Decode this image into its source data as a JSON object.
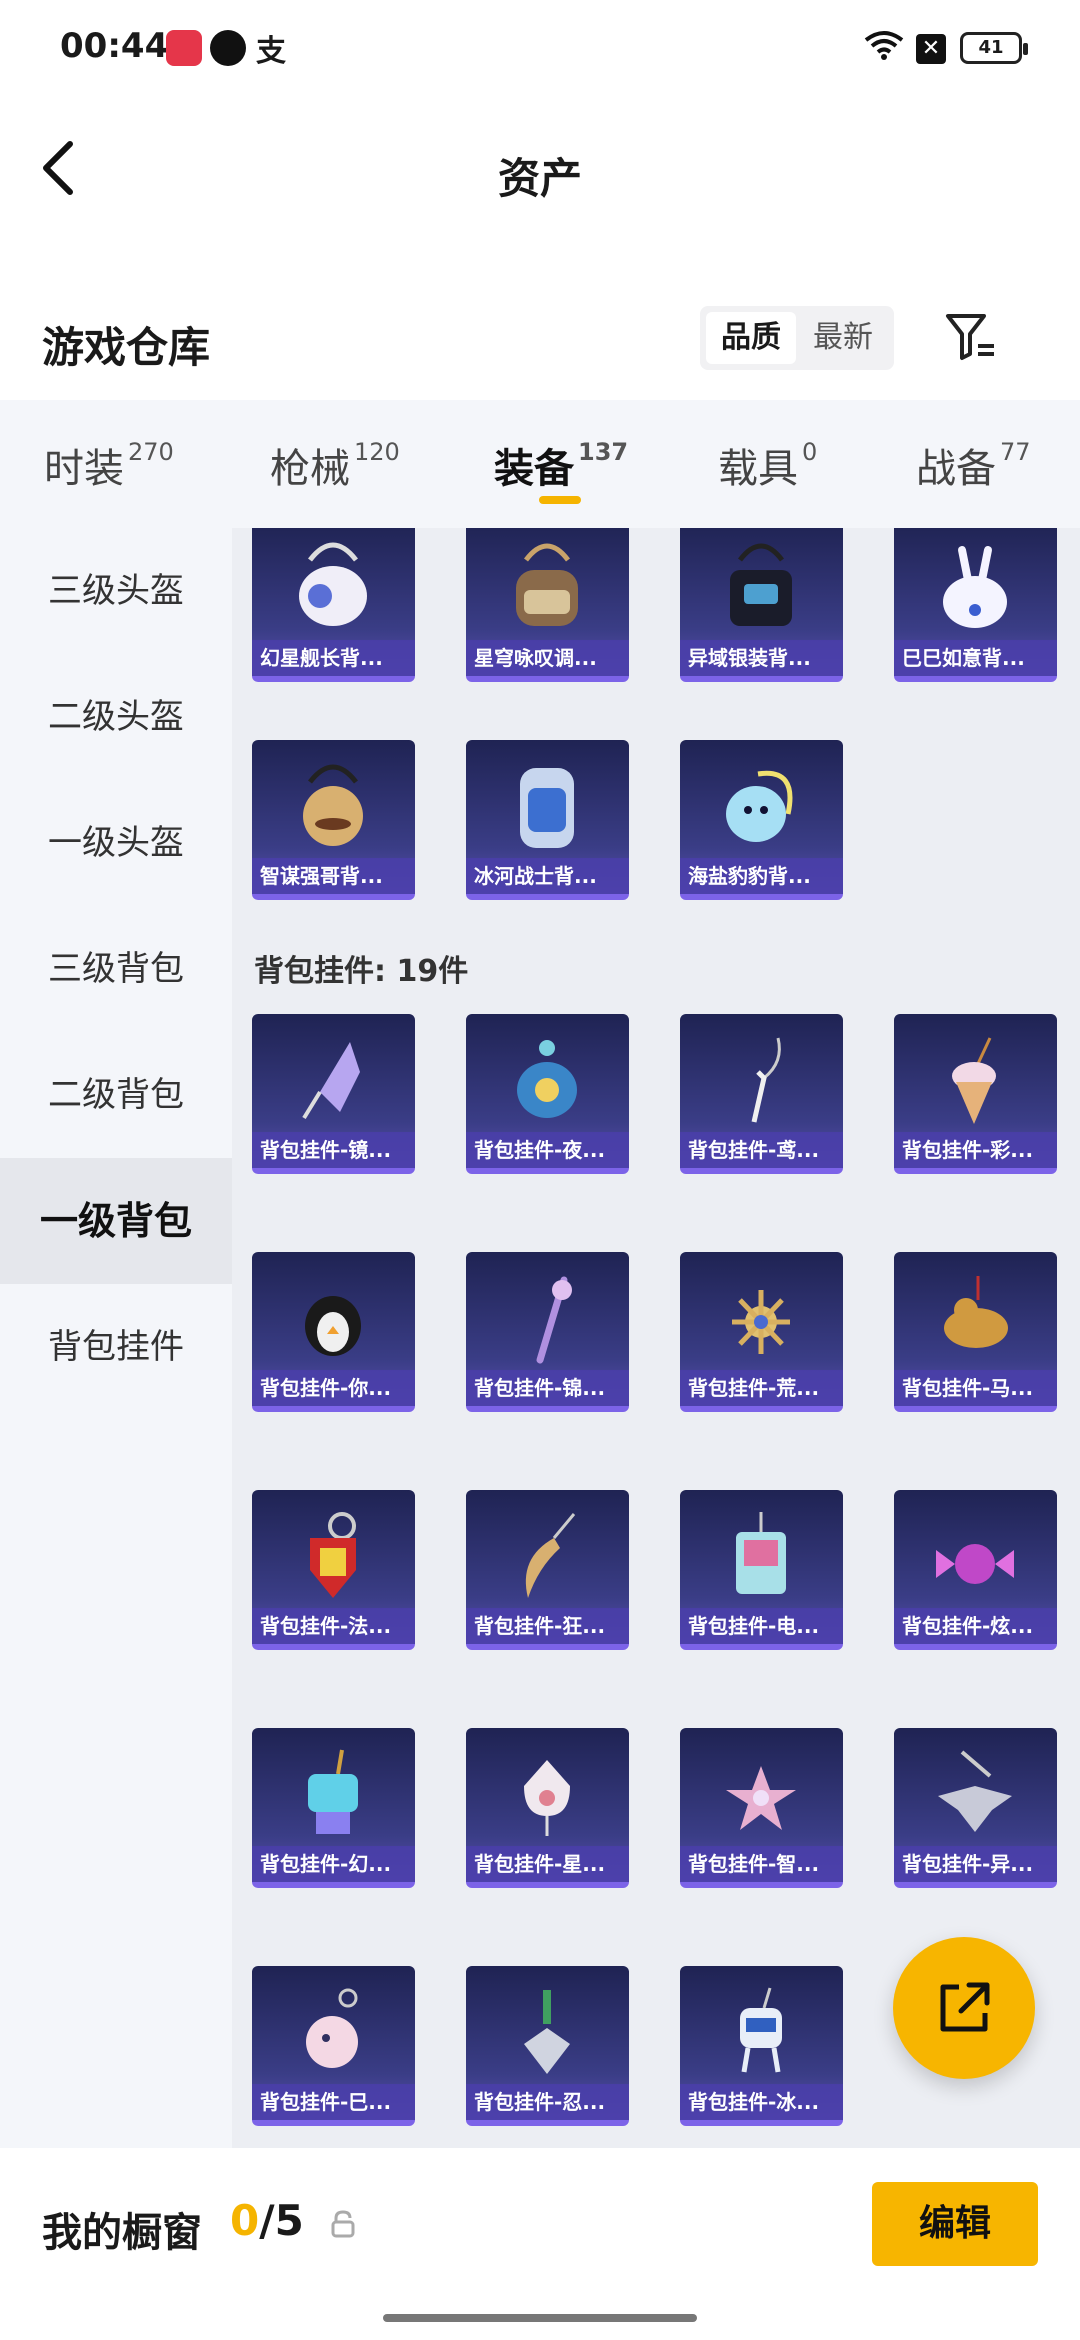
{
  "status": {
    "time": "00:44",
    "battery": "41"
  },
  "header": {
    "title": "资产"
  },
  "warehouse": {
    "title": "游戏仓库",
    "sort_quality": "品质",
    "sort_newest": "最新"
  },
  "tabs": [
    {
      "label": "时装",
      "count": "270"
    },
    {
      "label": "枪械",
      "count": "120"
    },
    {
      "label": "装备",
      "count": "137"
    },
    {
      "label": "载具",
      "count": "0"
    },
    {
      "label": "战备",
      "count": "77"
    }
  ],
  "sidebar": {
    "items": [
      "三级头盔",
      "二级头盔",
      "一级头盔",
      "三级背包",
      "二级背包",
      "一级背包",
      "背包挂件"
    ]
  },
  "backpacks": [
    "幻星舰长背...",
    "星穹咏叹调...",
    "异域银装背...",
    "巳巳如意背...",
    "智谋强哥背...",
    "冰河战士背...",
    "海盐豹豹背..."
  ],
  "charms_header": "背包挂件: 19件",
  "charms": [
    "背包挂件-镜...",
    "背包挂件-夜...",
    "背包挂件-鸢...",
    "背包挂件-彩...",
    "背包挂件-你...",
    "背包挂件-锦...",
    "背包挂件-荒...",
    "背包挂件-马...",
    "背包挂件-法...",
    "背包挂件-狂...",
    "背包挂件-电...",
    "背包挂件-炫...",
    "背包挂件-幻...",
    "背包挂件-星...",
    "背包挂件-智...",
    "背包挂件-异...",
    "背包挂件-巳...",
    "背包挂件-忍...",
    "背包挂件-冰..."
  ],
  "showcase": {
    "label": "我的橱窗",
    "current": "0",
    "total": "/5",
    "edit": "编辑"
  }
}
